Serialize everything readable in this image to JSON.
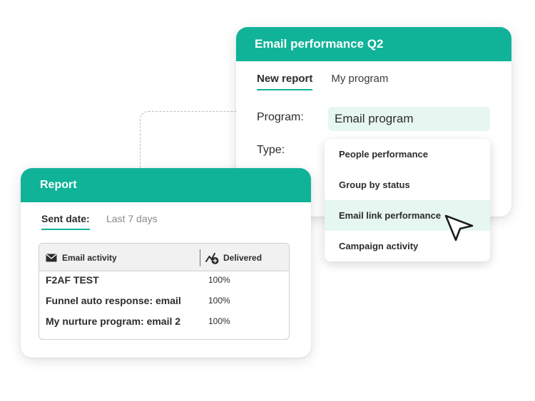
{
  "email_card": {
    "title": "Email performance Q2",
    "tabs": [
      {
        "label": "New report",
        "active": true
      },
      {
        "label": "My program",
        "active": false
      }
    ],
    "program_label": "Program:",
    "program_value": "Email program",
    "type_label": "Type:"
  },
  "dropdown": {
    "options": [
      {
        "label": "People performance",
        "highlighted": false
      },
      {
        "label": "Group by status",
        "highlighted": false
      },
      {
        "label": "Email link performance",
        "highlighted": true
      },
      {
        "label": "Campaign activity",
        "highlighted": false
      }
    ]
  },
  "report_card": {
    "title": "Report",
    "sent_date_label": "Sent date:",
    "range_value": "Last 7 days",
    "table": {
      "columns": [
        "Email activity",
        "Delivered"
      ],
      "rows": [
        {
          "name": "F2AF TEST",
          "delivered": "100%"
        },
        {
          "name": "Funnel auto response: email",
          "delivered": "100%"
        },
        {
          "name": "My nurture program: email 2",
          "delivered": "100%"
        }
      ]
    }
  },
  "colors": {
    "accent": "#10b398",
    "highlight": "#e6f6f1",
    "text": "#2c2c2c"
  },
  "icons": [
    "envelope-icon",
    "delivered-icon",
    "pointer-cursor-icon"
  ]
}
